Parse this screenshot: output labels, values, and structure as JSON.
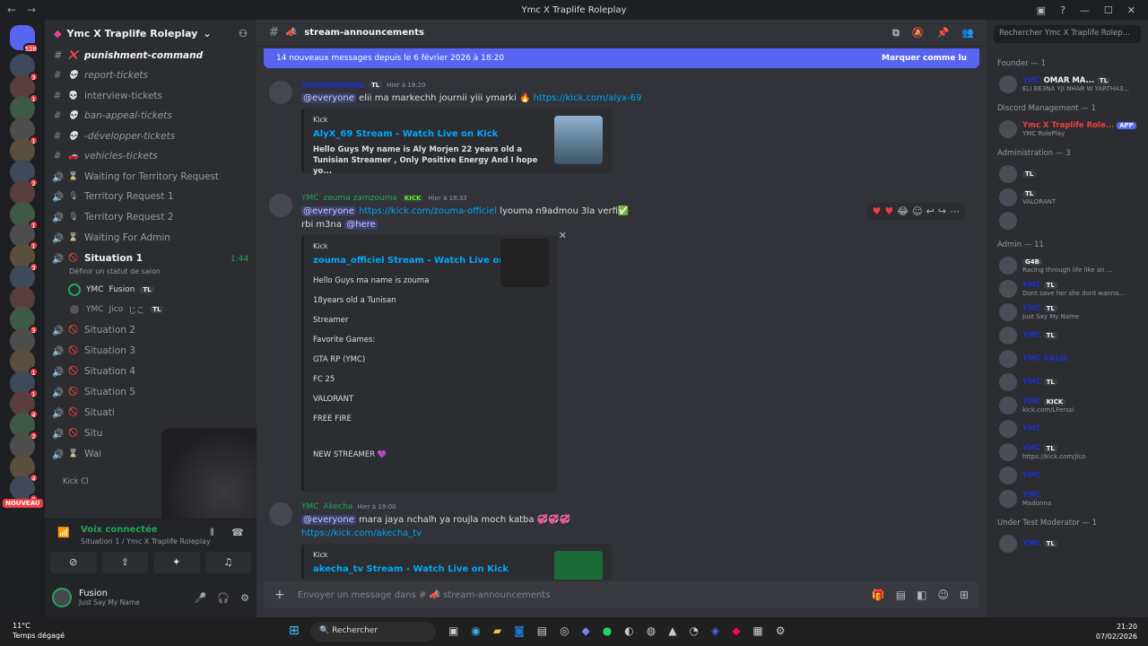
{
  "window": {
    "title": "Ymc X Traplife Roleplay",
    "colors": {
      "blurple": "#5865f2",
      "green": "#23a559",
      "red": "#f23f43"
    }
  },
  "servers": {
    "home_badge": "528",
    "new_label": "NOUVEAU",
    "badges": [
      "3",
      "1",
      "",
      "1",
      "",
      "2",
      "",
      "1",
      "1",
      "3",
      "",
      "",
      "3",
      "",
      "1",
      "1",
      "4",
      "2",
      "",
      "4",
      "9"
    ]
  },
  "guild": {
    "name": "Ymc X Traplife Roleplay",
    "channels": [
      {
        "name": "punishment-command",
        "emoji": "❌",
        "style": "bold italic"
      },
      {
        "name": "report-tickets",
        "emoji": "💀",
        "style": "italic"
      },
      {
        "name": "interview-tickets",
        "emoji": "💀",
        "style": ""
      },
      {
        "name": "ban-appeal-tickets",
        "emoji": "💀",
        "style": "italic"
      },
      {
        "name": "-développer-tickets",
        "emoji": "💀",
        "style": "italic"
      },
      {
        "name": "vehicles-tickets",
        "emoji": "🚗",
        "style": "italic"
      },
      {
        "name": "Waiting for Territory Request",
        "emoji": "⌛",
        "style": ""
      },
      {
        "name": "Territory Request 1",
        "emoji": "🎙",
        "style": ""
      },
      {
        "name": "Territory Request 2",
        "emoji": "🎙",
        "style": ""
      },
      {
        "name": "Waiting For Admin",
        "emoji": "⌛",
        "style": ""
      },
      {
        "name": "Situation 1",
        "emoji": "🚫",
        "style": "bold"
      },
      {
        "name": "Situation 2",
        "emoji": "🚫",
        "style": ""
      },
      {
        "name": "Situation 3",
        "emoji": "🚫",
        "style": ""
      },
      {
        "name": "Situation 4",
        "emoji": "🚫",
        "style": ""
      },
      {
        "name": "Situation 5",
        "emoji": "🚫",
        "style": ""
      },
      {
        "name": "Situati",
        "emoji": "🚫",
        "style": ""
      },
      {
        "name": "Situ",
        "emoji": "🚫",
        "style": ""
      },
      {
        "name": "Wai",
        "emoji": "⌛",
        "style": ""
      }
    ],
    "situation1_time": "1:44",
    "situation1_status": "Définir un statut de salon",
    "voice_users": [
      {
        "prefix": "YMC",
        "name": "Fusion",
        "tag": "TL"
      },
      {
        "prefix": "YMC",
        "name": "Jico",
        "suffix": "じこ",
        "tag": "TL"
      }
    ],
    "category_kick": "Kick Cl"
  },
  "voice_panel": {
    "status": "Voix connectée",
    "location": "Situation 1 / Ymc X Traplife Roleplay"
  },
  "user": {
    "name": "Fusion",
    "status": "Just Say My Name"
  },
  "channel": {
    "name": "stream-announcements",
    "banner_text": "14 nouveaux messages depuis le 6 février 2026 à 18:20",
    "banner_action": "Marquer comme lu"
  },
  "messages": [
    {
      "user": "Hier à 18:20",
      "text": "elii ma markechh journii yiii ymarki",
      "mention": "@everyone",
      "link": "https://kick.com/alyx-69",
      "embed": {
        "provider": "Kick",
        "title": "AlyX_69 Stream - Watch Live on Kick",
        "desc": "Hello Guys My name is Aly Morjen 22 years old a Tunisian Streamer , Only Positive Energy And I hope yo..."
      }
    },
    {
      "prefix": "YMC",
      "user": "zouma zamzouma",
      "badge": "KICK",
      "time": "Hier à 18:33",
      "mention": "@everyone",
      "link": "https://kick.com/zouma-officiel",
      "text": "lyouma n9admou 3la  verfi✅",
      "text2": "rbi m3na",
      "here": "@here",
      "embed": {
        "provider": "Kick",
        "title": "zouma_officiel Stream - Watch Live on Kick",
        "lines": [
          "Hello Guys ma name is zouma",
          "18years old a Tunisan",
          "Streamer",
          "Favorite Games:",
          "GTA RP (YMC)",
          "FC 25",
          "VALORANT",
          "FREE FIRE",
          "NEW STREAMER 💜"
        ]
      }
    },
    {
      "prefix": "YMC",
      "user": "Akecha",
      "time": "Hier à 19:00",
      "mention": "@everyone",
      "text": "mara jaya nchalh ya roujla moch katba 💞💞💞",
      "link": "https://kick.com/akecha_tv",
      "embed": {
        "provider": "Kick",
        "title": "akecha_tv Stream - Watch Live on Kick"
      }
    }
  ],
  "composer": {
    "placeholder": "Envoyer un message dans #",
    "channel": "stream-announcements"
  },
  "members": {
    "search": "Rechercher Ymc X Traplife Rolep...",
    "groups": [
      {
        "label": "Founder — 1",
        "members": [
          {
            "prefix": "YMC",
            "name": "OMAR MA...",
            "tag": "TL",
            "sub": "ELI BE3NA YJI NHAR W YARTHA3..."
          }
        ]
      },
      {
        "label": "Discord Management — 1",
        "members": [
          {
            "name": "Ymc X Traplife Role...",
            "tag": "APP",
            "sub": "YMC RolePlay"
          }
        ]
      },
      {
        "label": "Administration — 3",
        "members": [
          {
            "name": "",
            "tag": "TL"
          },
          {
            "name": "",
            "tag": "TL",
            "sub": "VALORANT"
          },
          {
            "name": ""
          }
        ]
      },
      {
        "label": "Admin — 11",
        "members": [
          {
            "name": "",
            "tag": "G4B",
            "sub": "Racing through life like an ..."
          },
          {
            "prefix": "YMC",
            "name": "",
            "tag": "TL",
            "sub": "Dont save her she dont wanna..."
          },
          {
            "prefix": "YMC",
            "name": "",
            "tag": "TL",
            "sub": "Just Say My Name"
          },
          {
            "prefix": "YMC",
            "name": "",
            "tag": "TL"
          },
          {
            "prefix": "YMC",
            "name": "KALIL"
          },
          {
            "prefix": "YMC",
            "name": "",
            "tag": "TL"
          },
          {
            "prefix": "YMC",
            "name": "",
            "tag": "KICK",
            "sub": "kick.com/LFerssi"
          },
          {
            "prefix": "YMC",
            "name": ""
          },
          {
            "prefix": "YMC",
            "name": "",
            "tag": "TL",
            "sub": "https://kick.com/jico"
          },
          {
            "prefix": "YMC",
            "name": ""
          },
          {
            "prefix": "YMC",
            "name": "",
            "sub": "Madonna"
          }
        ]
      },
      {
        "label": "Under Test Moderator — 1",
        "members": [
          {
            "prefix": "YMC",
            "name": "",
            "tag": "TL"
          }
        ]
      }
    ]
  },
  "taskbar": {
    "temp": "11°C",
    "weather": "Temps dégagé",
    "search": "Rechercher",
    "time": "21:20",
    "date": "07/02/2026"
  }
}
